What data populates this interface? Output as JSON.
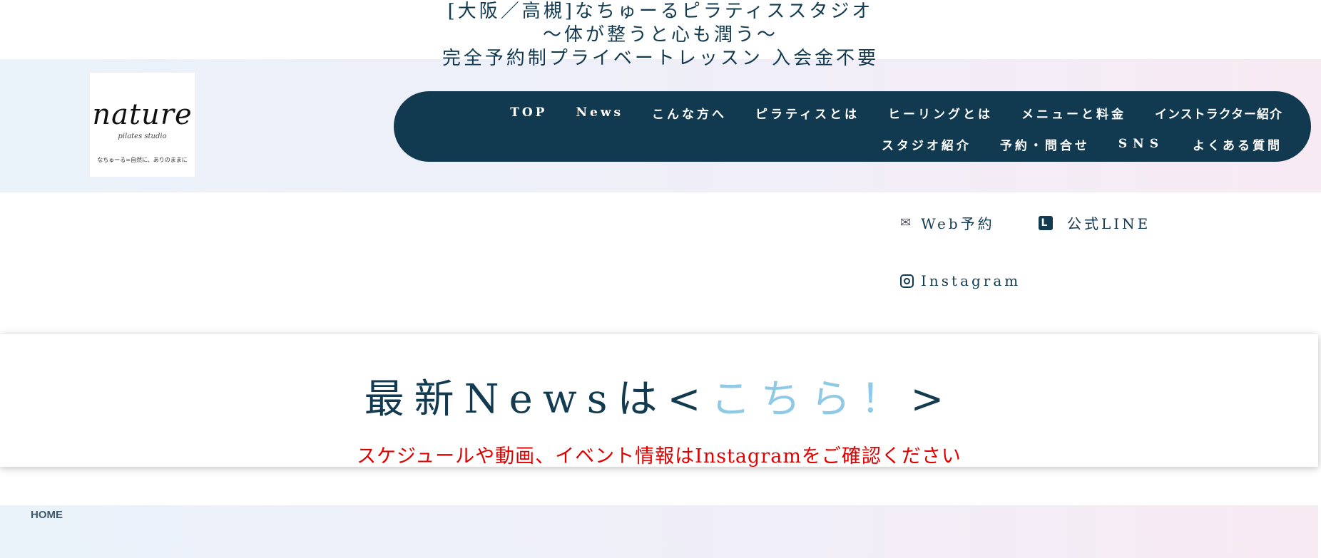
{
  "header": {
    "tagline": [
      "[大阪／高槻]なちゅーるピラティススタジオ",
      "〜体が整うと心も潤う〜",
      "完全予約制プライベートレッスン 入会金不要"
    ]
  },
  "logo": {
    "word": "nature",
    "sub": "pilates studio",
    "motto": "なちゅーる=自然に、ありのままに"
  },
  "nav": {
    "row1": [
      "TOP",
      "News",
      "こんな方へ",
      "ピラティスとは",
      "ヒーリングとは",
      "メニューと料金",
      "インストラクター紹介"
    ],
    "row2": [
      "スタジオ紹介",
      "予約・問合せ",
      "SNS",
      "よくある質問"
    ]
  },
  "links": {
    "web": "Web予約",
    "line": "公式LINE",
    "instagram": "Instagram"
  },
  "news": {
    "prefix": "最新Newsは<",
    "highlight": "こちら！",
    "suffix": ">",
    "note": "スケジュールや動画、イベント情報はInstagramをご確認ください"
  },
  "breadcrumb": {
    "home": "HOME"
  },
  "colors": {
    "navy": "#113a50",
    "accent": "#8ecae6",
    "alert": "#e00000"
  }
}
